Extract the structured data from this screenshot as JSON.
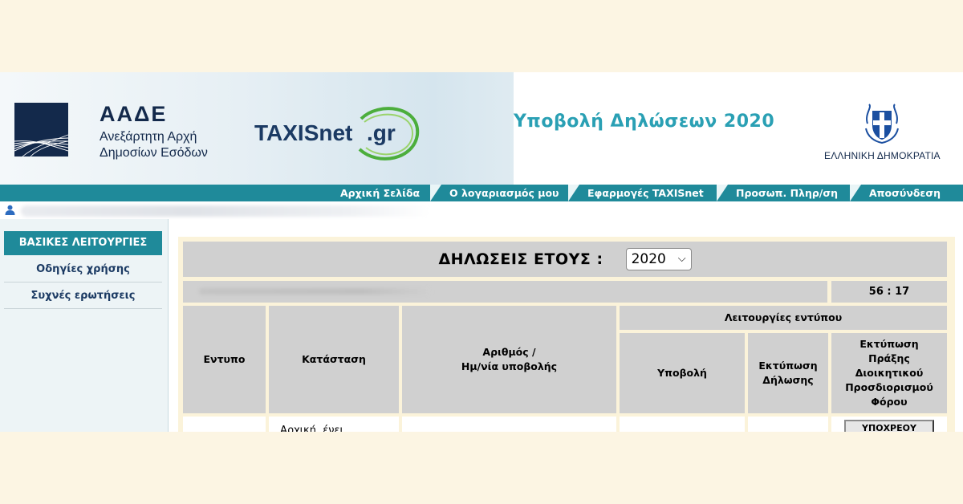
{
  "header": {
    "aade_acronym": "ΑΑΔΕ",
    "aade_name_line1": "Ανεξάρτητη Αρχή",
    "aade_name_line2": "Δημοσίων Εσόδων",
    "taxisnet_text": "TAXISnet",
    "taxisnet_gr": ".gr",
    "page_heading": "Υποβολή Δηλώσεων 2020",
    "greece_label": "ΕΛΛΗΝΙΚΗ ΔΗΜΟΚΡΑΤΙΑ"
  },
  "nav": {
    "items": [
      {
        "label": "Αρχική Σελίδα"
      },
      {
        "label": "Ο λογαριασμός μου"
      },
      {
        "label": "Εφαρμογές TAXISnet"
      },
      {
        "label": "Προσωπ. Πληρ/ση"
      },
      {
        "label": "Αποσύνδεση"
      }
    ]
  },
  "sidebar": {
    "title": "ΒΑΣΙΚΕΣ ΛΕΙΤΟΥΡΓΙΕΣ",
    "items": [
      {
        "label": "Οδηγίες χρήσης"
      },
      {
        "label": "Συχνές ερωτήσεις"
      }
    ]
  },
  "main": {
    "year_label": "ΔΗΛΩΣΕΙΣ ΕΤΟΥΣ :",
    "year_selected": "2020",
    "timer": "56 : 17",
    "table": {
      "headers": {
        "form": "Εντυπο",
        "status": "Κατάσταση",
        "number_date_line1": "Αριθμός /",
        "number_date_line2": "Ημ/νία υποβολής",
        "form_functions": "Λειτουργίες εντύπου",
        "submit": "Υποβολή",
        "print_declaration_line1": "Εκτύπωση",
        "print_declaration_line2": "Δήλωσης",
        "print_assessment_line1": "Εκτύπωση",
        "print_assessment_line2": "Πράξης",
        "print_assessment_line3": "Διοικητικού",
        "print_assessment_line4": "Προσδιορισμού",
        "print_assessment_line5": "Φόρου"
      },
      "first_row": {
        "status_partial": "Αρχική, ένει",
        "assessment_button": "ΥΠΟΧΡΕΟΥ"
      }
    }
  },
  "colors": {
    "nav_teal": "#1f8a9a",
    "heading_teal": "#2aa0b4",
    "aade_navy": "#13294b",
    "table_gray": "#d0d0d0",
    "panel_cream": "#fbf3da",
    "page_background": "#fcf5e3"
  }
}
